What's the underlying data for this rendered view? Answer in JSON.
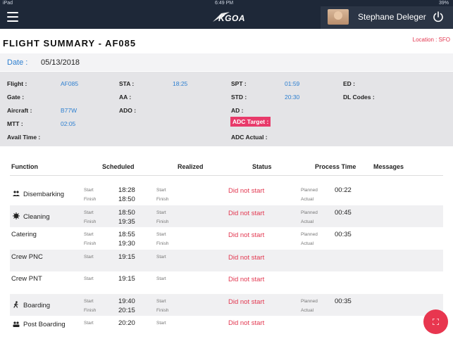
{
  "statusbar": {
    "left": "iPad",
    "time": "6:49 PM",
    "right": "39%"
  },
  "header": {
    "logo_text": "KGOA",
    "username": "Stephane Deleger"
  },
  "page": {
    "title": "FLIGHT SUMMARY - AF085",
    "location": "Location : SFO"
  },
  "date": {
    "label": "Date :",
    "value": "05/13/2018"
  },
  "info": {
    "flight_label": "Flight :",
    "flight_value": "AF085",
    "gate_label": "Gate :",
    "aircraft_label": "Aircraft :",
    "aircraft_value": "B77W",
    "mtt_label": "MTT :",
    "mtt_value": "02:05",
    "avail_label": "Avail Time :",
    "sta_label": "STA :",
    "sta_value": "18:25",
    "aa_label": "AA :",
    "ado_label": "ADO :",
    "spt_label": "SPT :",
    "spt_value": "01:59",
    "std_label": "STD :",
    "std_value": "20:30",
    "ad_label": "AD :",
    "adc_target_label": "ADC Target :",
    "adc_actual_label": "ADC Actual :",
    "ed_label": "ED :",
    "dl_label": "DL Codes :"
  },
  "table": {
    "headers": {
      "function": "Function",
      "scheduled": "Scheduled",
      "realized": "Realized",
      "status": "Status",
      "process": "Process Time",
      "messages": "Messages"
    },
    "labels": {
      "start": "Start",
      "finish": "Finish",
      "planned": "Planned",
      "actual": "Actual"
    },
    "rows": [
      {
        "function": "Disembarking",
        "icon": "people-icon",
        "start": "18:28",
        "finish": "18:50",
        "status": "Did not start",
        "planned": "00:22"
      },
      {
        "function": "Cleaning",
        "icon": "cleaning-icon",
        "start": "18:50",
        "finish": "19:35",
        "status": "Did not start",
        "planned": "00:45"
      },
      {
        "function": "Catering",
        "icon": "",
        "start": "18:55",
        "finish": "19:30",
        "status": "Did not start",
        "planned": "00:35"
      },
      {
        "function": "Crew PNC",
        "icon": "",
        "start": "19:15",
        "finish": "",
        "status": "Did not start",
        "planned": ""
      },
      {
        "function": "Crew PNT",
        "icon": "",
        "start": "19:15",
        "finish": "",
        "status": "Did not start",
        "planned": ""
      },
      {
        "function": "Boarding",
        "icon": "walking-icon",
        "start": "19:40",
        "finish": "20:15",
        "status": "Did not start",
        "planned": "00:35"
      },
      {
        "function": "Post Boarding",
        "icon": "post-boarding-icon",
        "start": "20:20",
        "finish": "",
        "status": "Did not start",
        "planned": ""
      }
    ]
  },
  "colors": {
    "header_bg": "#1e2838",
    "accent_blue": "#2d7fd0",
    "alert_red": "#e2364f",
    "adc_target_bg": "#e83a6a"
  },
  "fab": {
    "icon": "expand-icon"
  }
}
